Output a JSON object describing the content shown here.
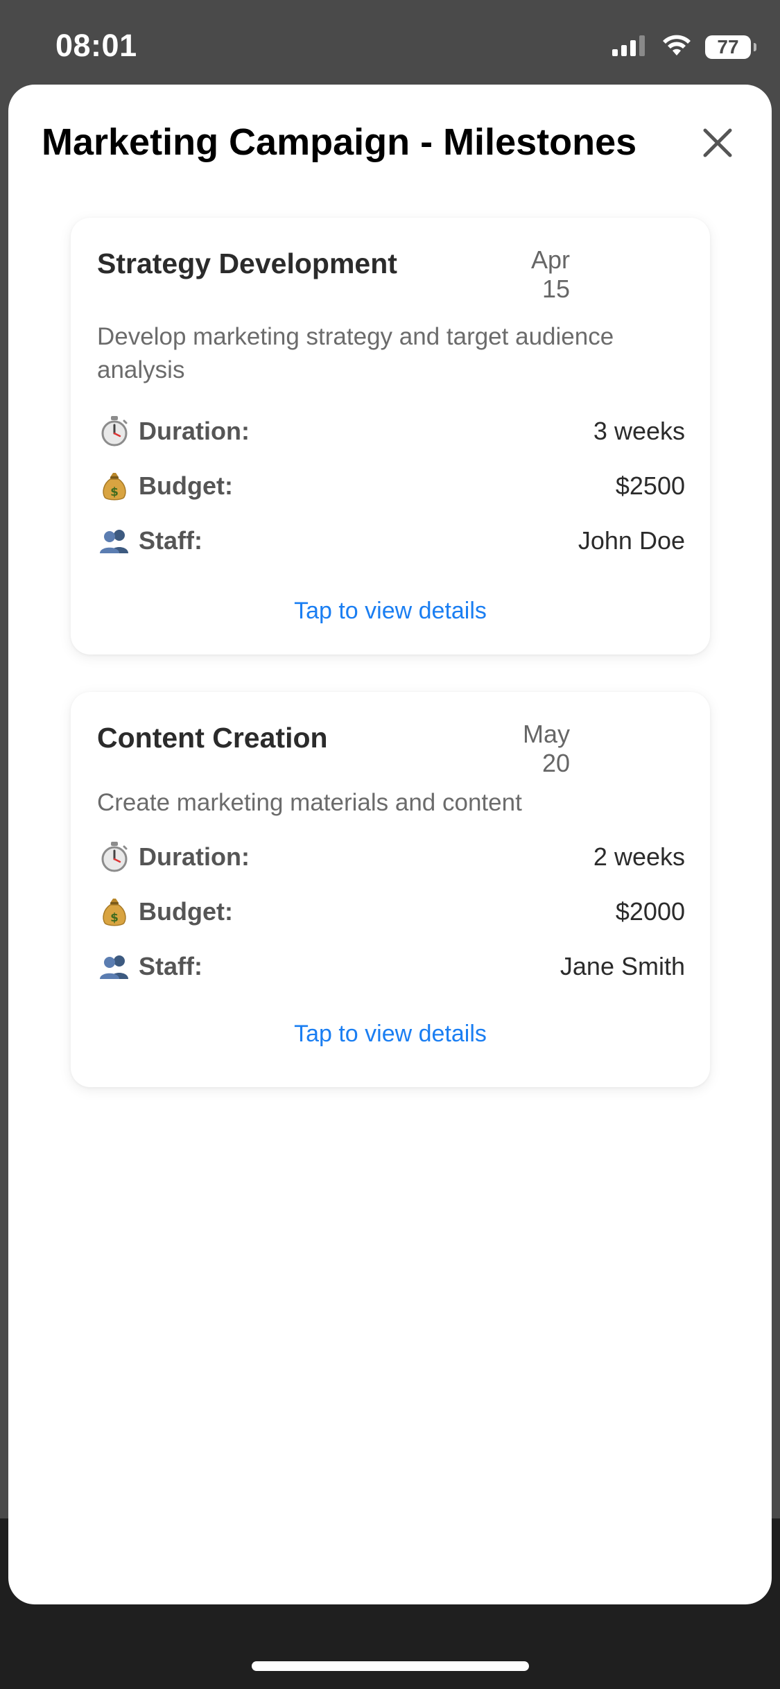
{
  "status_bar": {
    "time": "08:01",
    "battery": "77"
  },
  "sheet": {
    "title": "Marketing Campaign - Milestones",
    "close_icon": "close-icon"
  },
  "labels": {
    "duration": "Duration:",
    "budget": "Budget:",
    "staff": "Staff:",
    "tap_details": "Tap to view details"
  },
  "icons": {
    "duration": "stopwatch-icon",
    "budget": "money-bag-icon",
    "staff": "people-icon"
  },
  "milestones": [
    {
      "title": "Strategy Development",
      "date_month": "Apr",
      "date_day": "15",
      "description": "Develop marketing strategy and target audience analysis",
      "duration": "3 weeks",
      "budget": "$2500",
      "staff": "John Doe"
    },
    {
      "title": "Content Creation",
      "date_month": "May",
      "date_day": "20",
      "description": "Create marketing materials and content",
      "duration": "2 weeks",
      "budget": "$2000",
      "staff": "Jane Smith"
    }
  ],
  "colors": {
    "accent_link": "#1a7ef2",
    "backdrop": "#4a4a4a"
  }
}
